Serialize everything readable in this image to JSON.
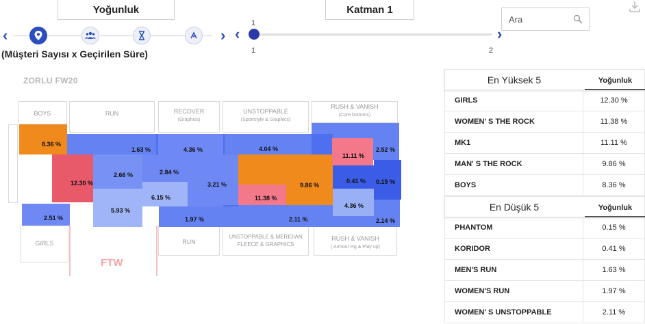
{
  "header": {
    "metric_selector": "Yoğunluk",
    "layer_selector": "Katman 1",
    "metric_caption": "(Müşteri Sayısı x Geçirilen Süre)"
  },
  "steps": [
    {
      "icon": "location-pin-icon",
      "active": true
    },
    {
      "icon": "people-icon",
      "active": false
    },
    {
      "icon": "hourglass-icon",
      "active": false
    },
    {
      "icon": "flow-icon",
      "active": false
    }
  ],
  "slider": {
    "min_label": "1",
    "max_label": "2",
    "current_label": "1",
    "value": 1
  },
  "search": {
    "placeholder": "Ara"
  },
  "floor": {
    "title": "ZORLU FW20",
    "zones": {
      "boys": "BOYS",
      "run_top": "RUN",
      "recover": "RECOVER",
      "recover_sub": "(Graphics)",
      "unstoppable": "UNSTOPPABLE",
      "unstoppable_sub": "(Sportstyle & Graphics)",
      "rush_top": "RUSH & VANISH",
      "rush_top_sub": "(Core bottoms)",
      "girls": "GIRLS",
      "run_bottom": "RUN",
      "unstoppable_meridian": "UNSTOPPABLE & MERIDIAN",
      "unstoppable_meridian_sub": "FLEECE & GRAPHICS",
      "rush_bottom": "RUSH & VANISH",
      "rush_bottom_sub": "( Armour Hg & Play up)",
      "ftw": "FTW"
    },
    "heat_labels": {
      "c836": "8.36 %",
      "c163": "1.63 %",
      "c436a": "4.36 %",
      "c404": "4.04 %",
      "c252": "2.52 %",
      "c1111": "11.11 %",
      "c1230": "12.30 %",
      "c266": "2.66 %",
      "c284": "2.84 %",
      "c321": "3.21 %",
      "c615": "6.15 %",
      "c1138": "11.38 %",
      "c986": "9.86 %",
      "c041": "0.41 %",
      "c015": "0.15 %",
      "c436b": "4.36 %",
      "c251": "2.51 %",
      "c593": "5.93 %",
      "c197": "1.97 %",
      "c211": "2.11 %",
      "c214": "2.14 %"
    }
  },
  "top5": {
    "title": "En Yüksek 5",
    "column": "Yoğunluk",
    "rows": [
      {
        "name": "GIRLS",
        "value": "12.30 %"
      },
      {
        "name": "WOMEN' S THE ROCK",
        "value": "11.38 %"
      },
      {
        "name": "MK1",
        "value": "11.11 %"
      },
      {
        "name": "MAN' S THE ROCK",
        "value": "9.86 %"
      },
      {
        "name": "BOYS",
        "value": "8.36 %"
      }
    ]
  },
  "bottom5": {
    "title": "En Düşük 5",
    "column": "Yoğunluk",
    "rows": [
      {
        "name": "PHANTOM",
        "value": "0.15 %"
      },
      {
        "name": "KORIDOR",
        "value": "0.41 %"
      },
      {
        "name": "MEN'S RUN",
        "value": "1.63 %"
      },
      {
        "name": "WOMEN'S RUN",
        "value": "1.97 %"
      },
      {
        "name": "WOMEN' S UNSTOPPABLE",
        "value": "2.11 %"
      }
    ]
  },
  "colors": {
    "accent": "#2a4ebd",
    "heat_blue": "#4a6cf0",
    "heat_light_blue": "#7f9cf5",
    "heat_orange": "#f08a1c",
    "heat_red": "#e8596a",
    "heat_pink": "#f3788a"
  }
}
